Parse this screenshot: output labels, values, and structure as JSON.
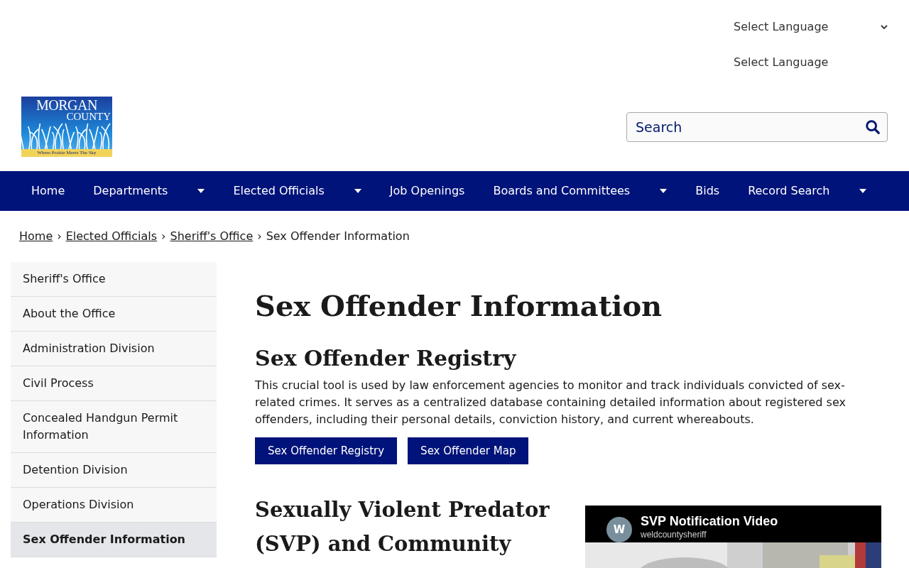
{
  "language": {
    "dropdown_label": "Select Language",
    "second_label": "Select Language"
  },
  "logo": {
    "line1": "MORGAN",
    "line2": "COUNTY",
    "tagline": "Where Prairie Meets The Sky"
  },
  "search": {
    "placeholder": "Search"
  },
  "nav": [
    {
      "label": "Home",
      "has_menu": false
    },
    {
      "label": "Departments",
      "has_menu": true
    },
    {
      "label": "Elected Officials",
      "has_menu": true
    },
    {
      "label": "Job Openings",
      "has_menu": false
    },
    {
      "label": "Boards and Committees",
      "has_menu": true
    },
    {
      "label": "Bids",
      "has_menu": false
    },
    {
      "label": "Record Search",
      "has_menu": true
    }
  ],
  "breadcrumb": {
    "links": [
      "Home",
      "Elected Officials",
      "Sheriff's Office"
    ],
    "separator": "›",
    "current": "Sex Offender Information"
  },
  "sidebar": [
    {
      "label": "Sheriff's Office",
      "selected": false
    },
    {
      "label": "About the Office",
      "selected": false
    },
    {
      "label": "Administration Division",
      "selected": false
    },
    {
      "label": "Civil Process",
      "selected": false
    },
    {
      "label": "Concealed Handgun Permit Information",
      "selected": false
    },
    {
      "label": "Detention Division",
      "selected": false
    },
    {
      "label": "Operations Division",
      "selected": false
    },
    {
      "label": "Sex Offender Information",
      "selected": true
    }
  ],
  "page_title": "Sex Offender Information",
  "registry": {
    "heading": "Sex Offender Registry",
    "text": "This crucial tool is used by law enforcement agencies to monitor and track individuals convicted of sex-related crimes. It serves as a centralized database containing detailed information about registered sex offenders, including their personal details, conviction history, and current whereabouts.",
    "buttons": [
      "Sex Offender Registry",
      "Sex Offender Map"
    ]
  },
  "svp": {
    "heading": "Sexually Violent Predator (SVP) and Community"
  },
  "video": {
    "kind": "picture",
    "title": "SVP Notification Video",
    "channel": "weldcountysheriff",
    "avatar_letter": "W"
  }
}
